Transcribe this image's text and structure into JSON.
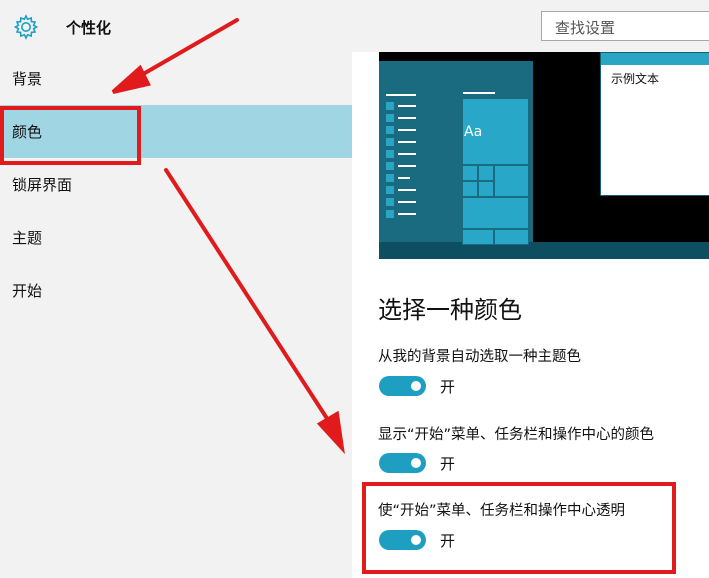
{
  "app": {
    "title": "个性化",
    "icon": "gear-icon"
  },
  "search": {
    "placeholder": "查找设置"
  },
  "sidebar": {
    "items": [
      {
        "label": "背景",
        "selected": false
      },
      {
        "label": "颜色",
        "selected": true
      },
      {
        "label": "锁屏界面",
        "selected": false
      },
      {
        "label": "主题",
        "selected": false
      },
      {
        "label": "开始",
        "selected": false
      }
    ]
  },
  "preview": {
    "tile_label": "Aa",
    "sample_text": "示例文本"
  },
  "main": {
    "section_title": "选择一种颜色",
    "options": [
      {
        "label": "从我的背景自动选取一种主题色",
        "state": "开",
        "on": true
      },
      {
        "label": "显示“开始”菜单、任务栏和操作中心的颜色",
        "state": "开",
        "on": true
      },
      {
        "label": "使“开始”菜单、任务栏和操作中心透明",
        "state": "开",
        "on": true
      }
    ]
  },
  "colors": {
    "accent": "#1e9fc2",
    "selected_nav": "#a0d6e4",
    "annotation": "#e11b1b",
    "sidebar_bg": "#f2f2f2"
  }
}
